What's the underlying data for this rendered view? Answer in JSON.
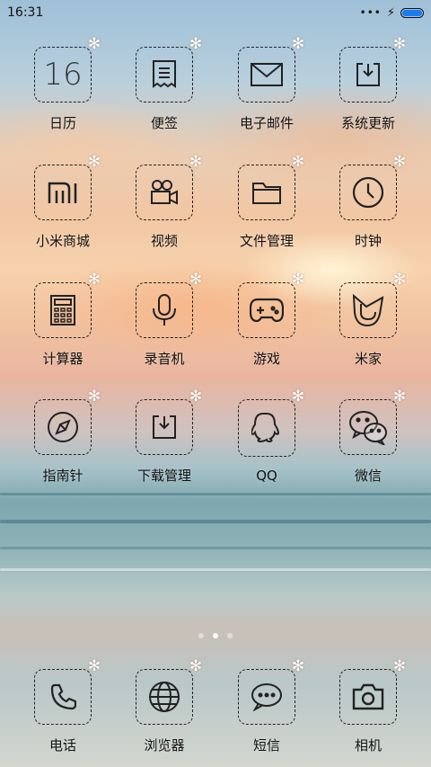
{
  "status": {
    "time": "16:31",
    "more": "•••"
  },
  "apps": [
    {
      "label": "日历",
      "icon": "calendar-icon",
      "icon_text": "16"
    },
    {
      "label": "便签",
      "icon": "notes-icon"
    },
    {
      "label": "电子邮件",
      "icon": "mail-icon"
    },
    {
      "label": "系统更新",
      "icon": "system-update-icon"
    },
    {
      "label": "小米商城",
      "icon": "mi-store-icon"
    },
    {
      "label": "视频",
      "icon": "video-icon"
    },
    {
      "label": "文件管理",
      "icon": "folder-icon"
    },
    {
      "label": "时钟",
      "icon": "clock-icon"
    },
    {
      "label": "计算器",
      "icon": "calculator-icon"
    },
    {
      "label": "录音机",
      "icon": "microphone-icon"
    },
    {
      "label": "游戏",
      "icon": "gamepad-icon"
    },
    {
      "label": "米家",
      "icon": "mijia-icon"
    },
    {
      "label": "指南针",
      "icon": "compass-icon"
    },
    {
      "label": "下载管理",
      "icon": "download-icon"
    },
    {
      "label": "QQ",
      "icon": "qq-icon"
    },
    {
      "label": "微信",
      "icon": "wechat-icon"
    }
  ],
  "dock": [
    {
      "label": "电话",
      "icon": "phone-icon"
    },
    {
      "label": "浏览器",
      "icon": "browser-globe-icon"
    },
    {
      "label": "短信",
      "icon": "message-icon"
    },
    {
      "label": "相机",
      "icon": "camera-icon"
    }
  ],
  "pagination": {
    "pages": 3,
    "current": 2
  }
}
